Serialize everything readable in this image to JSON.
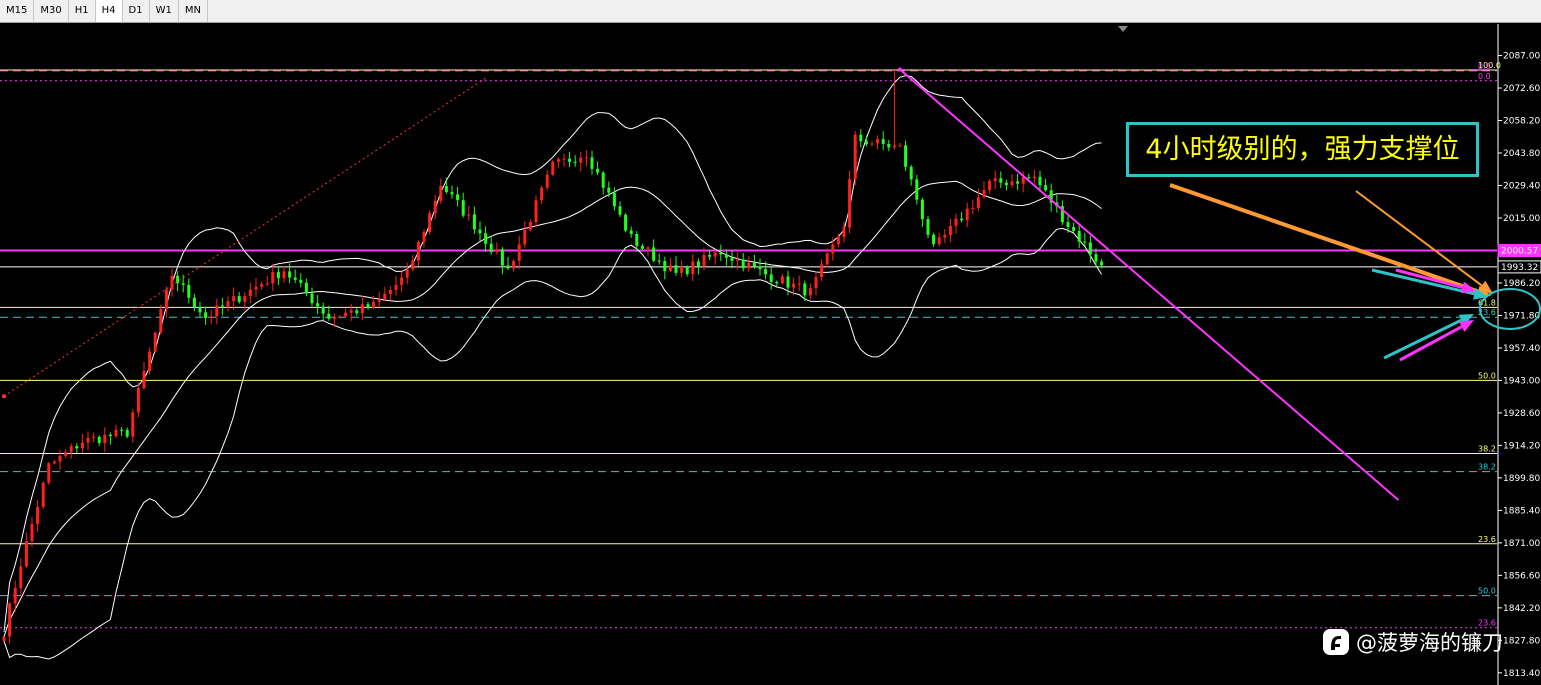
{
  "toolbar": {
    "timeframes": [
      "M15",
      "M30",
      "H1",
      "H4",
      "D1",
      "W1",
      "MN"
    ],
    "active": "H4"
  },
  "annotation": "4小时级别的，强力支撑位",
  "watermark": {
    "text": "@菠萝海的镰刀",
    "icon": "platform-logo-icon"
  },
  "colors": {
    "bull": "#ff2020",
    "bear": "#20ff20",
    "bands": "#ffffff",
    "trendline": "#ff33ff",
    "fib_yellow": "#ffff80",
    "fib_cyan": "#33cccc",
    "arrow_orange": "#ff9933",
    "circle": "#2fc3c8"
  },
  "chart_data": {
    "type": "candlestick",
    "symbol_timeframe": "H4",
    "ylim": [
      1808,
      2093
    ],
    "y_ticks": [
      "2087.00",
      "2072.60",
      "2058.20",
      "2043.80",
      "2029.40",
      "2015.00",
      "2000.60",
      "1986.20",
      "1971.80",
      "1957.40",
      "1943.00",
      "1928.60",
      "1914.20",
      "1899.80",
      "1885.40",
      "1871.00",
      "1856.60",
      "1842.20",
      "1827.80",
      "1813.40"
    ],
    "price_labels": [
      {
        "value": 2000.57,
        "text": "2000.57",
        "color": "#ff33ff"
      },
      {
        "value": 1993.32,
        "text": "1993.32",
        "color": "#ffffff"
      }
    ],
    "fib_levels": [
      {
        "price": 2080.6,
        "label": "100.0",
        "color": "#ffff80",
        "style": "solid"
      },
      {
        "price": 2080.2,
        "label": "0.0",
        "color": "#ff33ff",
        "style": "dashed"
      },
      {
        "price": 2075.8,
        "label": "0.0",
        "color": "#ff33ff",
        "style": "dotted"
      },
      {
        "price": 1975.4,
        "label": "61.8",
        "color": "#ffff80",
        "style": "solid"
      },
      {
        "price": 1971.0,
        "label": "23.6",
        "color": "#33cccc",
        "style": "dashed"
      },
      {
        "price": 1943.0,
        "label": "50.0",
        "color": "#ffff80",
        "style": "solid"
      },
      {
        "price": 1910.6,
        "label": "38.2",
        "color": "#ffff80",
        "style": "solid"
      },
      {
        "price": 1902.6,
        "label": "38.2",
        "color": "#33cccc",
        "style": "dashed"
      },
      {
        "price": 1870.6,
        "label": "23.6",
        "color": "#ffff80",
        "style": "solid"
      },
      {
        "price": 1847.6,
        "label": "50.0",
        "color": "#33cccc",
        "style": "dashed"
      },
      {
        "price": 1833.4,
        "label": "23.6",
        "color": "#ff33ff",
        "style": "dotted"
      }
    ],
    "horizontal_lines": [
      {
        "price": 2000.57,
        "color": "#ff33ff"
      },
      {
        "price": 1993.32,
        "color": "#ffffff"
      }
    ],
    "trendlines": [
      {
        "from": {
          "bar": 160,
          "price": 2080.8
        },
        "to": {
          "bar": 249,
          "price": 1890.0
        },
        "color": "#ff33ff",
        "style": "solid"
      },
      {
        "from": {
          "bar": 0,
          "price": 1936.0
        },
        "to": {
          "bar": 86,
          "price": 2077.0
        },
        "color": "#ff3030",
        "style": "dotted"
      }
    ],
    "segments": [
      [
        0,
        1832
      ],
      [
        3,
        1862
      ],
      [
        8,
        1905
      ],
      [
        14,
        1916
      ],
      [
        22,
        1920
      ],
      [
        30,
        1990
      ],
      [
        36,
        1971
      ],
      [
        42,
        1980
      ],
      [
        50,
        1992
      ],
      [
        58,
        1971
      ],
      [
        66,
        1976
      ],
      [
        72,
        1990
      ],
      [
        78,
        2030
      ],
      [
        84,
        2012
      ],
      [
        90,
        1992
      ],
      [
        98,
        2038
      ],
      [
        104,
        2044
      ],
      [
        112,
        2006
      ],
      [
        120,
        1990
      ],
      [
        128,
        2000
      ],
      [
        136,
        1990
      ],
      [
        144,
        1982
      ],
      [
        150,
        2012
      ],
      [
        152,
        2050
      ],
      [
        160,
        2046
      ],
      [
        166,
        2001
      ],
      [
        176,
        2030
      ],
      [
        184,
        2033
      ],
      [
        190,
        2012
      ],
      [
        196,
        1994
      ]
    ]
  }
}
